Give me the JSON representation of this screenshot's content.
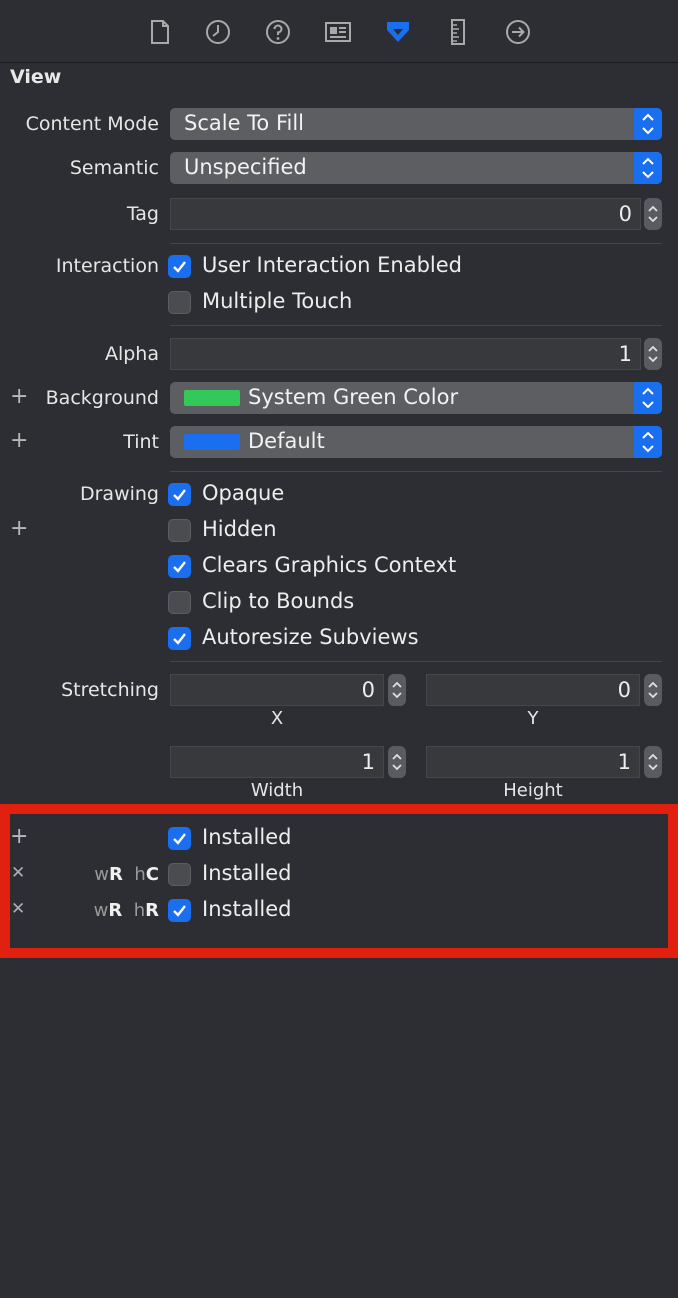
{
  "toolbar": {
    "icons": [
      "file-icon",
      "clock-history-icon",
      "help-icon",
      "identity-icon",
      "attributes-icon",
      "ruler-icon",
      "connections-arrow-icon"
    ],
    "active_icon": "attributes-icon",
    "accent": "#1a6ff0"
  },
  "section_title": "View",
  "content_mode": {
    "label": "Content Mode",
    "value": "Scale To Fill"
  },
  "semantic": {
    "label": "Semantic",
    "value": "Unspecified"
  },
  "tag": {
    "label": "Tag",
    "value": "0"
  },
  "interaction": {
    "label": "Interaction",
    "user_interaction_enabled": {
      "label": "User Interaction Enabled",
      "checked": true
    },
    "multiple_touch": {
      "label": "Multiple Touch",
      "checked": false
    }
  },
  "alpha": {
    "label": "Alpha",
    "value": "1"
  },
  "background": {
    "label": "Background",
    "value": "System Green Color",
    "swatch": "#34c759"
  },
  "tint": {
    "label": "Tint",
    "value": "Default",
    "swatch": "#1a6ff0"
  },
  "drawing": {
    "label": "Drawing",
    "opaque": {
      "label": "Opaque",
      "checked": true
    },
    "hidden": {
      "label": "Hidden",
      "checked": false
    },
    "clears_graphics_context": {
      "label": "Clears Graphics Context",
      "checked": true
    },
    "clip_to_bounds": {
      "label": "Clip to Bounds",
      "checked": false
    },
    "autoresize_subviews": {
      "label": "Autoresize Subviews",
      "checked": true
    }
  },
  "stretching": {
    "label": "Stretching",
    "x": {
      "value": "0",
      "caption": "X"
    },
    "y": {
      "value": "0",
      "caption": "Y"
    },
    "width": {
      "value": "1",
      "caption": "Width"
    },
    "height": {
      "value": "1",
      "caption": "Height"
    }
  },
  "installed": [
    {
      "label": "Installed",
      "checked": true,
      "w_prefix": "",
      "w_val": "",
      "h_prefix": "",
      "h_val": ""
    },
    {
      "label": "Installed",
      "checked": false,
      "w_prefix": "w",
      "w_val": "R",
      "h_prefix": "h",
      "h_val": "C"
    },
    {
      "label": "Installed",
      "checked": true,
      "w_prefix": "w",
      "w_val": "R",
      "h_prefix": "h",
      "h_val": "R"
    }
  ],
  "highlight_color": "#e1200f"
}
